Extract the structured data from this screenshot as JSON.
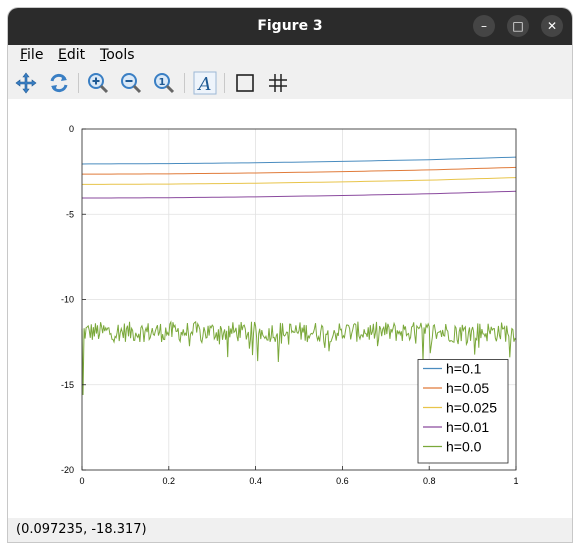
{
  "window": {
    "title": "Figure 3",
    "minimize_glyph": "–",
    "maximize_glyph": "□",
    "close_glyph": "✕"
  },
  "menu": [
    {
      "label": "File",
      "mnemonic": "F",
      "rest": "ile"
    },
    {
      "label": "Edit",
      "mnemonic": "E",
      "rest": "dit"
    },
    {
      "label": "Tools",
      "mnemonic": "T",
      "rest": "ools"
    }
  ],
  "toolbar": {
    "icons": [
      "pan-icon",
      "rotate-icon",
      "zoom-in-icon",
      "zoom-out-icon",
      "zoom-reset-icon",
      "text-icon",
      "axes-box-icon",
      "grid-icon"
    ],
    "text_glyph": "A",
    "zoom_reset_glyph": "1"
  },
  "status": {
    "coordinates": "(0.097235, -18.317)"
  },
  "chart_data": {
    "type": "line",
    "xlim": [
      0,
      1
    ],
    "ylim": [
      -20,
      0
    ],
    "xticks": [
      0,
      0.2,
      0.4,
      0.6,
      0.8,
      1
    ],
    "xtick_labels": [
      "0",
      "0.2",
      "0.4",
      "0.6",
      "0.8",
      "1"
    ],
    "yticks": [
      0,
      -5,
      -10,
      -15,
      -20
    ],
    "ytick_labels": [
      "0",
      "-5",
      "-10",
      "-15",
      "-20"
    ],
    "grid": true,
    "legend_position": "bottom-right",
    "series": [
      {
        "name": "h=0.1",
        "color": "#4a8cbf",
        "x": [
          0,
          0.2,
          0.4,
          0.6,
          0.8,
          1
        ],
        "y": [
          -2.05,
          -2.03,
          -1.98,
          -1.9,
          -1.8,
          -1.65
        ]
      },
      {
        "name": "h=0.05",
        "color": "#e07b3a",
        "x": [
          0,
          0.2,
          0.4,
          0.6,
          0.8,
          1
        ],
        "y": [
          -2.65,
          -2.63,
          -2.58,
          -2.5,
          -2.4,
          -2.25
        ]
      },
      {
        "name": "h=0.025",
        "color": "#e8c44a",
        "x": [
          0,
          0.2,
          0.4,
          0.6,
          0.8,
          1
        ],
        "y": [
          -3.25,
          -3.23,
          -3.18,
          -3.1,
          -3.0,
          -2.85
        ]
      },
      {
        "name": "h=0.01",
        "color": "#8a4a9e",
        "x": [
          0,
          0.2,
          0.4,
          0.6,
          0.8,
          1
        ],
        "y": [
          -4.05,
          -4.03,
          -3.98,
          -3.9,
          -3.8,
          -3.65
        ]
      },
      {
        "name": "h=0.0",
        "color": "#7aa83a",
        "noisy": true,
        "mean": -11.9,
        "amplitude": 0.6,
        "min_spike": -15.6
      }
    ]
  }
}
